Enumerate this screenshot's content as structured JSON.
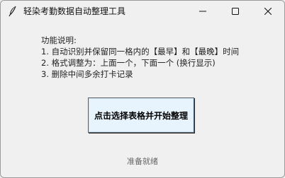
{
  "window": {
    "title": "轻染考勤数据自动整理工具",
    "icons": {
      "app": "feather-icon",
      "minimize": "minimize-icon",
      "maximize": "maximize-icon",
      "close": "close-icon"
    }
  },
  "description": {
    "heading": "功能说明:",
    "lines": [
      "1. 自动识别并保留同一格内的【最早】和【最晚】时间",
      "2. 格式调整为：上面一个，下面一个 (换行显示)",
      "3. 删除中间多余打卡记录"
    ]
  },
  "main_button": {
    "label": "点击选择表格并开始整理"
  },
  "status": {
    "text": "准备就绪"
  },
  "colors": {
    "window_bg": "#f0f0f0",
    "button_bg": "#e7f3fd",
    "status_text": "#666666"
  }
}
